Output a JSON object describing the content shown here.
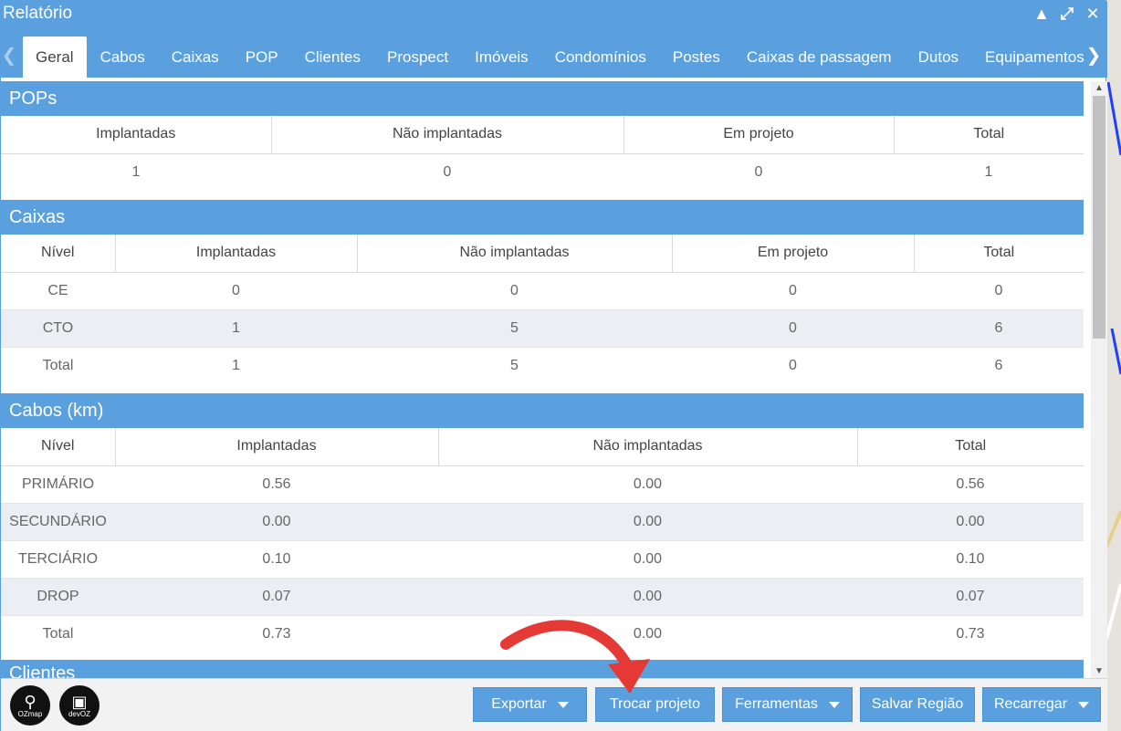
{
  "window": {
    "title": "Relatório"
  },
  "tabs": [
    "Geral",
    "Cabos",
    "Caixas",
    "POP",
    "Clientes",
    "Prospect",
    "Imóveis",
    "Condomínios",
    "Postes",
    "Caixas de passagem",
    "Dutos",
    "Equipamentos"
  ],
  "active_tab": "Geral",
  "pops": {
    "title": "POPs",
    "headers": [
      "Implantadas",
      "Não implantadas",
      "Em projeto",
      "Total"
    ],
    "row": [
      "1",
      "0",
      "0",
      "1"
    ]
  },
  "caixas": {
    "title": "Caixas",
    "headers": [
      "Nível",
      "Implantadas",
      "Não implantadas",
      "Em projeto",
      "Total"
    ],
    "rows": [
      [
        "CE",
        "0",
        "0",
        "0",
        "0"
      ],
      [
        "CTO",
        "1",
        "5",
        "0",
        "6"
      ],
      [
        "Total",
        "1",
        "5",
        "0",
        "6"
      ]
    ]
  },
  "cabos": {
    "title": "Cabos (km)",
    "headers": [
      "Nível",
      "Implantadas",
      "Não implantadas",
      "Total"
    ],
    "rows": [
      [
        "PRIMÁRIO",
        "0.56",
        "0.00",
        "0.56"
      ],
      [
        "SECUNDÁRIO",
        "0.00",
        "0.00",
        "0.00"
      ],
      [
        "TERCIÁRIO",
        "0.10",
        "0.00",
        "0.10"
      ],
      [
        "DROP",
        "0.07",
        "0.00",
        "0.07"
      ],
      [
        "Total",
        "0.73",
        "0.00",
        "0.73"
      ]
    ]
  },
  "clientes": {
    "title": "Clientes"
  },
  "footer": {
    "logos": [
      {
        "caption": "OZmap",
        "icon": "map-pin-icon"
      },
      {
        "caption": "devOZ",
        "icon": "dev-logo-icon"
      }
    ],
    "buttons": {
      "exportar": "Exportar",
      "trocar": "Trocar projeto",
      "ferramentas": "Ferramentas",
      "salvar": "Salvar Região",
      "recarregar": "Recarregar"
    }
  },
  "colors": {
    "accent": "#5aa0de",
    "annotation_arrow": "#e53935"
  }
}
